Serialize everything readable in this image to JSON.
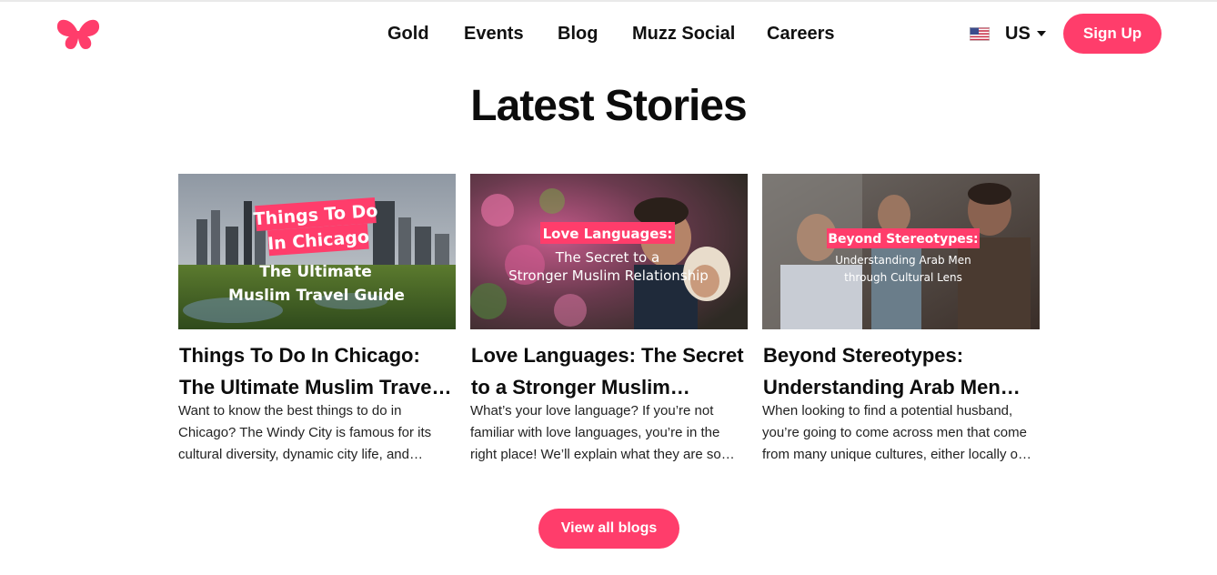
{
  "nav": {
    "items": [
      {
        "label": "Gold"
      },
      {
        "label": "Events"
      },
      {
        "label": "Blog"
      },
      {
        "label": "Muzz Social"
      },
      {
        "label": "Careers"
      }
    ],
    "locale": "US",
    "signup_label": "Sign Up"
  },
  "colors": {
    "brand": "#ff3d6b"
  },
  "icons": {
    "logo": "butterfly-logo-icon",
    "flag": "us-flag-icon",
    "caret": "caret-down-icon"
  },
  "main": {
    "title": "Latest Stories",
    "cards": [
      {
        "image_overlay": {
          "tag_line1": "Things To Do",
          "tag_line2": "In Chicago",
          "sub_line1": "The Ultimate",
          "sub_line2": "Muslim Travel Guide"
        },
        "title": "Things To Do In Chicago: The Ultimate Muslim Travel Guide",
        "excerpt": "Want to know the best things to do in Chicago? The Windy City is famous for its cultural diversity, dynamic city life, and spectacular architecture."
      },
      {
        "image_overlay": {
          "tag_line1": "Love Languages:",
          "sub_line1": "The Secret to a",
          "sub_line2": "Stronger Muslim Relationship"
        },
        "title": "Love Languages: The Secret to a Stronger Muslim Relationship",
        "excerpt": "What’s your love language? If you’re not familiar with love languages, you’re in the right place! We’ll explain what they are so you can"
      },
      {
        "image_overlay": {
          "tag_line1": "Beyond Stereotypes:",
          "sub_line1": "Understanding Arab Men",
          "sub_line2": "through Cultural Lens"
        },
        "title": "Beyond Stereotypes: Understanding Arab Men through Cultural Lens",
        "excerpt": "When looking to find a potential husband, you’re going to come across men that come from many unique cultures, either locally or abroad."
      }
    ],
    "view_all_label": "View all blogs"
  }
}
